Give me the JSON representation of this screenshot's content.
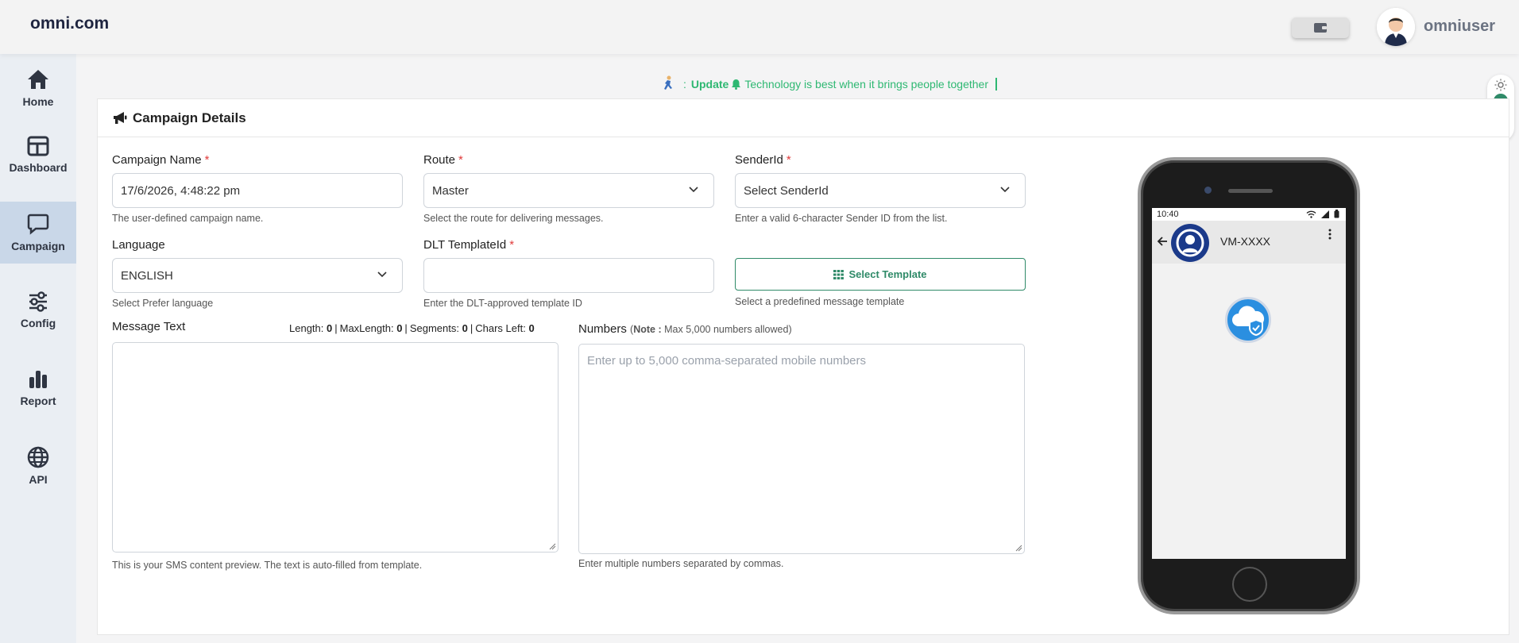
{
  "brand": "omni.com",
  "user": {
    "name": "omniuser"
  },
  "sidebar": {
    "items": [
      {
        "label": "Home",
        "icon": "home-icon"
      },
      {
        "label": "Dashboard",
        "icon": "dashboard-icon"
      },
      {
        "label": "Campaign",
        "icon": "chat-icon",
        "active": true
      },
      {
        "label": "Config",
        "icon": "sliders-icon"
      },
      {
        "label": "Report",
        "icon": "bar-chart-icon"
      },
      {
        "label": "API",
        "icon": "globe-icon"
      }
    ]
  },
  "ticker": {
    "prefix": ":",
    "update": "Update",
    "message": "Technology is best when it brings people together"
  },
  "card": {
    "title": "Campaign Details"
  },
  "form": {
    "campaign_name": {
      "label": "Campaign Name",
      "value": "17/6/2026, 4:48:22 pm",
      "help": "The user-defined campaign name."
    },
    "route": {
      "label": "Route",
      "value": "Master",
      "help": "Select the route for delivering messages."
    },
    "sender_id": {
      "label": "SenderId",
      "value": "Select SenderId",
      "help": "Enter a valid 6-character Sender ID from the list."
    },
    "language": {
      "label": "Language",
      "value": "ENGLISH",
      "help": "Select Prefer language"
    },
    "dlt_template": {
      "label": "DLT TemplateId",
      "value": "",
      "help": "Enter the DLT-approved template ID"
    },
    "select_template": {
      "label": "Select Template",
      "help": "Select a predefined message template"
    },
    "message": {
      "label": "Message Text",
      "length_label": "Length:",
      "length": "0",
      "maxlength_label": "MaxLength:",
      "maxlength": "0",
      "segments_label": "Segments:",
      "segments": "0",
      "chars_left_label": "Chars Left:",
      "chars_left": "0",
      "help": "This is your SMS content preview. The text is auto-filled from template."
    },
    "numbers": {
      "label": "Numbers",
      "note_label": "Note :",
      "note": "Max 5,000 numbers allowed",
      "placeholder": "Enter up to 5,000 comma-separated mobile numbers",
      "help": "Enter multiple numbers separated by commas."
    }
  },
  "phone": {
    "time": "10:40",
    "contact": "VM-XXXX"
  },
  "colors": {
    "accent": "#2f8a68",
    "ticker": "#2eb872",
    "required": "#e03b3b",
    "avatar_bg": "#1b3a8a"
  }
}
